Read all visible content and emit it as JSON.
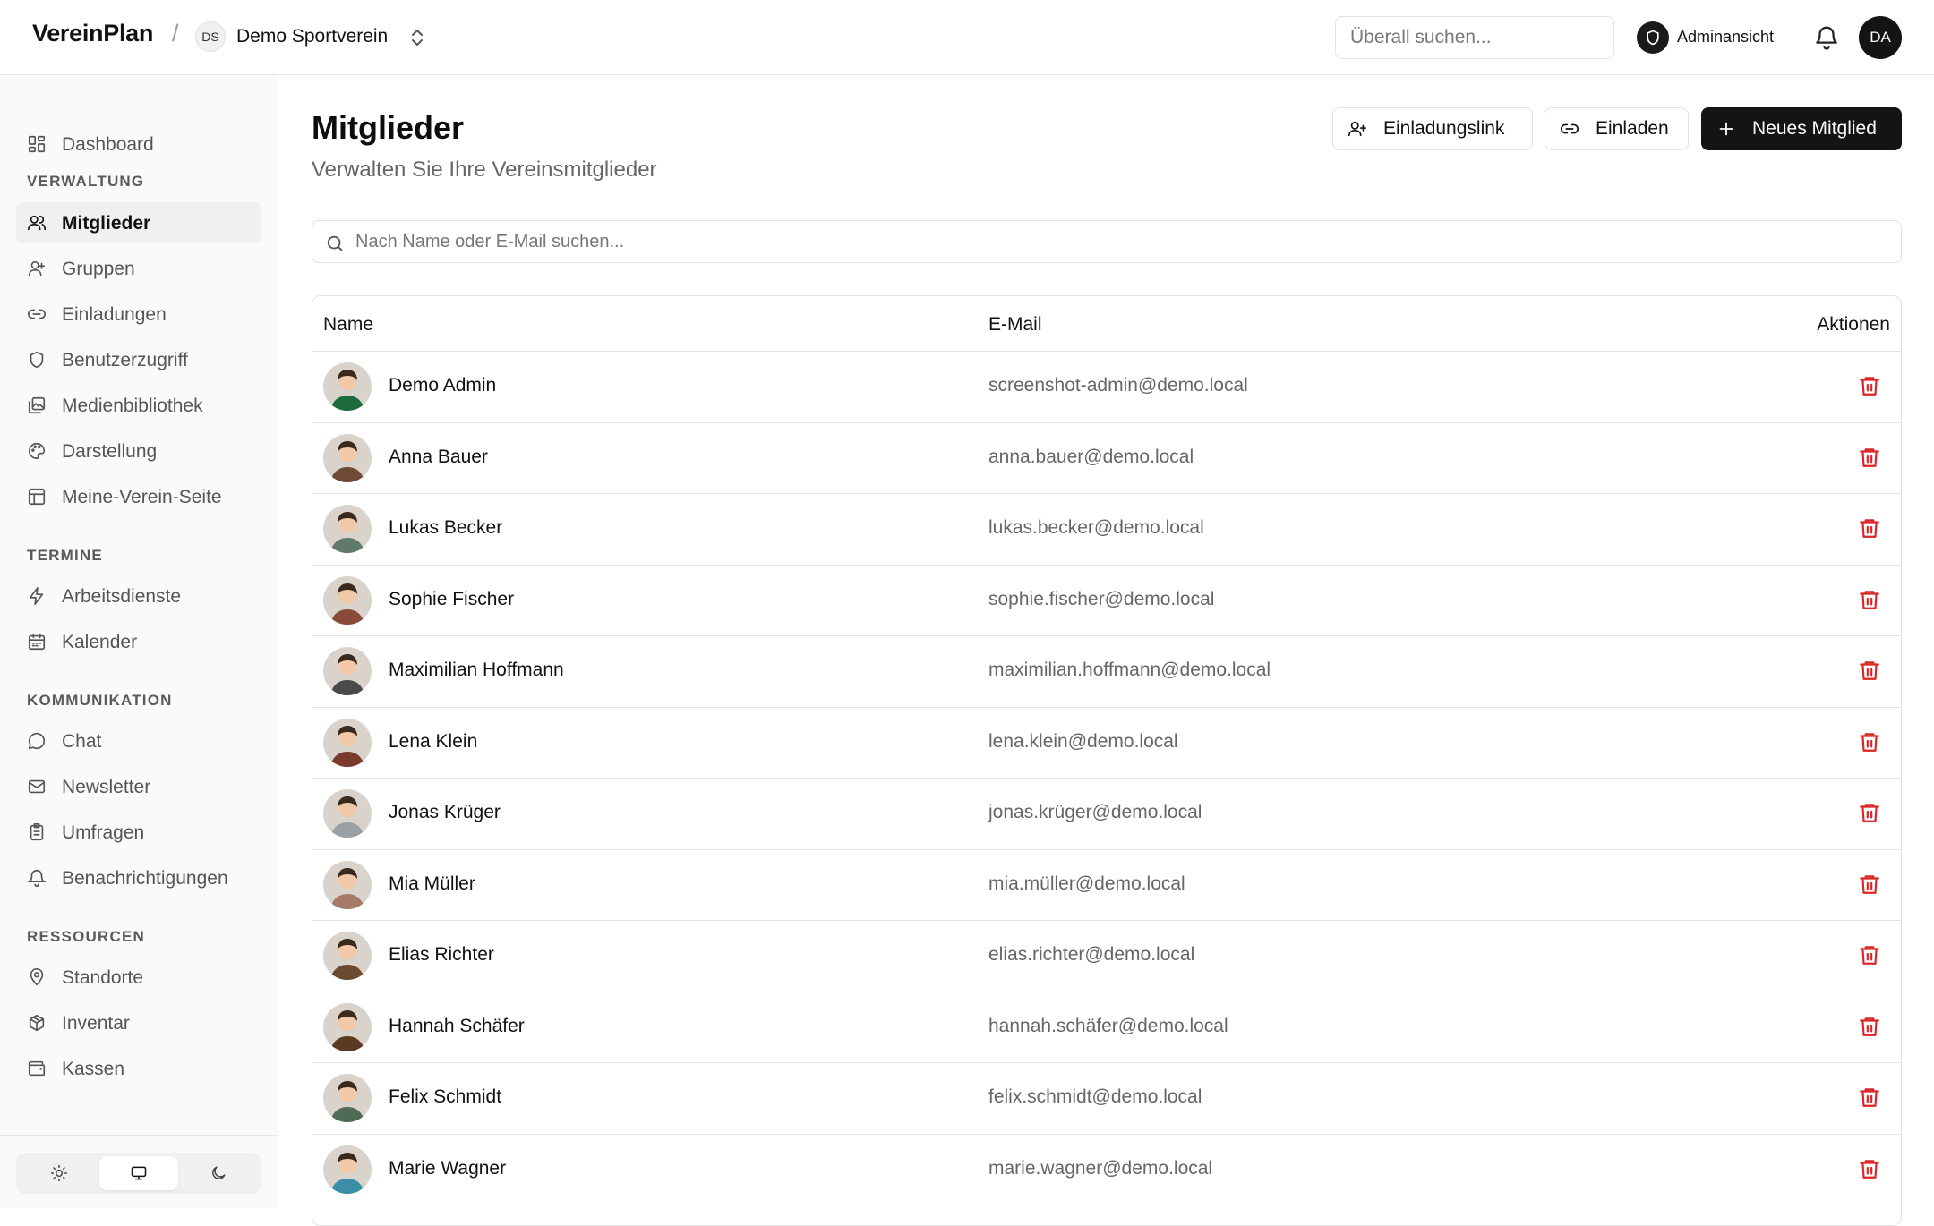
{
  "header": {
    "brand": "VereinPlan",
    "separator": "/",
    "org_initials": "DS",
    "org_name": "Demo Sportverein",
    "search_placeholder": "Überall suchen...",
    "admin_label": "Adminansicht",
    "user_initials": "DA"
  },
  "sidebar": {
    "dashboard": "Dashboard",
    "sections": [
      {
        "label": "VERWALTUNG",
        "items": [
          "Mitglieder",
          "Gruppen",
          "Einladungen",
          "Benutzerzugriff",
          "Medienbibliothek",
          "Darstellung",
          "Meine-Verein-Seite"
        ]
      },
      {
        "label": "TERMINE",
        "items": [
          "Arbeitsdienste",
          "Kalender"
        ]
      },
      {
        "label": "KOMMUNIKATION",
        "items": [
          "Chat",
          "Newsletter",
          "Umfragen",
          "Benachrichtigungen"
        ]
      },
      {
        "label": "RESSOURCEN",
        "items": [
          "Standorte",
          "Inventar",
          "Kassen"
        ]
      }
    ],
    "active_item": "Mitglieder"
  },
  "main": {
    "title": "Mitglieder",
    "subtitle": "Verwalten Sie Ihre Vereinsmitglieder",
    "buttons": {
      "invite_link": "Einladungslink",
      "invite": "Einladen",
      "new_member": "Neues Mitglied"
    },
    "search_placeholder": "Nach Name oder E-Mail suchen...",
    "columns": {
      "name": "Name",
      "email": "E-Mail",
      "actions": "Aktionen"
    },
    "rows": [
      {
        "name": "Demo Admin",
        "email": "screenshot-admin@demo.local",
        "color": "#1d6b3a"
      },
      {
        "name": "Anna Bauer",
        "email": "anna.bauer@demo.local",
        "color": "#6e4a36"
      },
      {
        "name": "Lukas Becker",
        "email": "lukas.becker@demo.local",
        "color": "#5f7a6a"
      },
      {
        "name": "Sophie Fischer",
        "email": "sophie.fischer@demo.local",
        "color": "#8a4a3a"
      },
      {
        "name": "Maximilian Hoffmann",
        "email": "maximilian.hoffmann@demo.local",
        "color": "#4a4a4a"
      },
      {
        "name": "Lena Klein",
        "email": "lena.klein@demo.local",
        "color": "#7a3a2e"
      },
      {
        "name": "Jonas Krüger",
        "email": "jonas.krüger@demo.local",
        "color": "#9aa0a6"
      },
      {
        "name": "Mia Müller",
        "email": "mia.müller@demo.local",
        "color": "#a57a68"
      },
      {
        "name": "Elias Richter",
        "email": "elias.richter@demo.local",
        "color": "#6a4b32"
      },
      {
        "name": "Hannah Schäfer",
        "email": "hannah.schäfer@demo.local",
        "color": "#5c3a22"
      },
      {
        "name": "Felix Schmidt",
        "email": "felix.schmidt@demo.local",
        "color": "#4f6b55"
      },
      {
        "name": "Marie Wagner",
        "email": "marie.wagner@demo.local",
        "color": "#3a8ea5"
      }
    ]
  },
  "colors": {
    "accent": "#141414",
    "danger": "#dc2626",
    "muted": "#666666",
    "border": "#e2e2e2"
  }
}
